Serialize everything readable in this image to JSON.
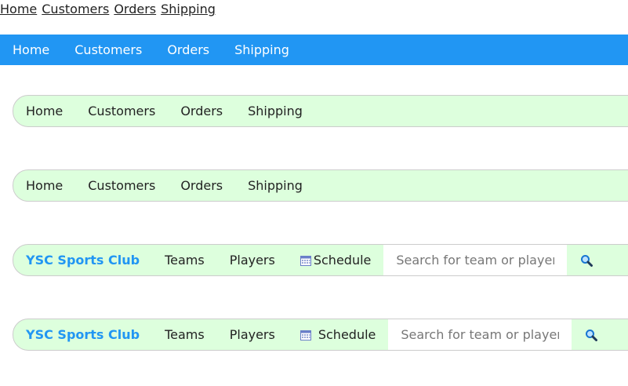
{
  "nav_plain": {
    "items": [
      "Home",
      "Customers",
      "Orders",
      "Shipping"
    ]
  },
  "nav_blue": {
    "items": [
      "Home",
      "Customers",
      "Orders",
      "Shipping"
    ],
    "bg": "#2196f3"
  },
  "nav_green1": {
    "items": [
      "Home",
      "Customers",
      "Orders",
      "Shipping"
    ],
    "bg": "#ddffdd"
  },
  "nav_green2": {
    "items": [
      "Home",
      "Customers",
      "Orders",
      "Shipping"
    ],
    "bg": "#ddffdd"
  },
  "nav_club1": {
    "brand": "YSC Sports Club",
    "teams": "Teams",
    "players": "Players",
    "schedule": "Schedule",
    "schedule_icon": "calendar-icon",
    "search_placeholder": "Search for team or player..",
    "search_icon": "magnifier-icon",
    "brand_color": "#2196f3"
  },
  "nav_club2": {
    "brand": "YSC Sports Club",
    "teams": "Teams",
    "players": "Players",
    "schedule": "Schedule",
    "schedule_icon": "calendar-icon",
    "search_placeholder": "Search for team or player..",
    "search_icon": "magnifier-icon",
    "brand_color": "#2196f3"
  }
}
